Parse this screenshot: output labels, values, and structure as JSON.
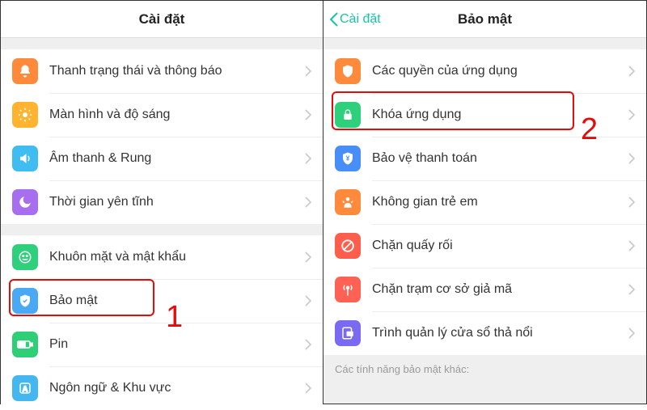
{
  "left": {
    "title": "Cài đặt",
    "group1": [
      {
        "label": "Thanh trạng thái và thông báo",
        "icon": "bell-icon",
        "color": "c-orange"
      },
      {
        "label": "Màn hình và độ sáng",
        "icon": "sun-icon",
        "color": "c-yellow"
      },
      {
        "label": "Âm thanh & Rung",
        "icon": "speaker-icon",
        "color": "c-cyan"
      },
      {
        "label": "Thời gian yên tĩnh",
        "icon": "moon-icon",
        "color": "c-purple"
      }
    ],
    "group2": [
      {
        "label": "Khuôn mặt và mật khẩu",
        "icon": "face-icon",
        "color": "c-green"
      },
      {
        "label": "Bảo mật",
        "icon": "shield-icon",
        "color": "c-sky"
      },
      {
        "label": "Pin",
        "icon": "battery-icon",
        "color": "c-greenL"
      },
      {
        "label": "Ngôn ngữ & Khu vực",
        "icon": "globe-icon",
        "color": "c-teal"
      }
    ]
  },
  "right": {
    "back": "Cài đặt",
    "title": "Bảo mật",
    "items": [
      {
        "label": "Các quyền của ứng dụng",
        "icon": "shield-icon",
        "color": "c-orange"
      },
      {
        "label": "Khóa ứng dụng",
        "icon": "lock-icon",
        "color": "c-green"
      },
      {
        "label": "Bảo vệ thanh toán",
        "icon": "payment-shield-icon",
        "color": "c-blue"
      },
      {
        "label": "Không gian trẻ em",
        "icon": "child-icon",
        "color": "c-orange"
      },
      {
        "label": "Chặn quấy rối",
        "icon": "block-icon",
        "color": "c-red"
      },
      {
        "label": "Chặn trạm cơ sở giả mã",
        "icon": "antenna-icon",
        "color": "c-redA"
      },
      {
        "label": "Trình quản lý cửa sổ thả nổi",
        "icon": "window-icon",
        "color": "c-violet"
      }
    ],
    "sectionFooter": "Các tính năng bảo mật khác:"
  },
  "annotations": {
    "one": "1",
    "two": "2"
  }
}
